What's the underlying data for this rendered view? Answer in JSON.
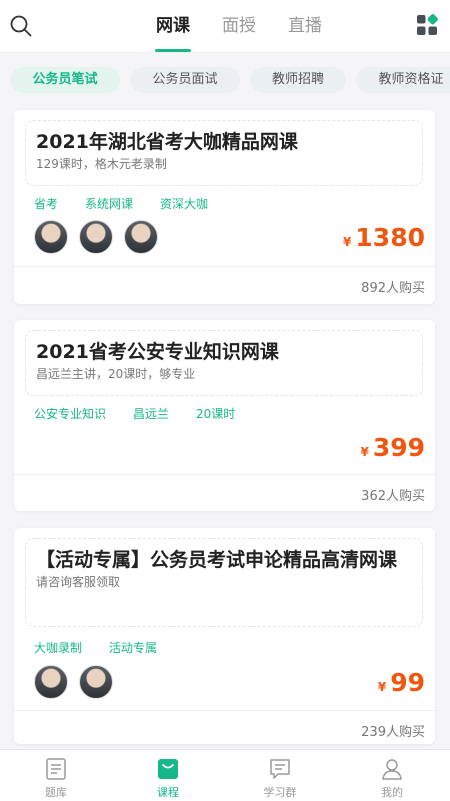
{
  "header": {
    "tabs": [
      {
        "label": "网课",
        "active": true
      },
      {
        "label": "面授",
        "active": false
      },
      {
        "label": "直播",
        "active": false
      }
    ],
    "icons": {
      "left": "search-icon",
      "right": "apps-grid-icon"
    }
  },
  "categories": [
    {
      "label": "公务员笔试",
      "active": true
    },
    {
      "label": "公务员面试",
      "active": false
    },
    {
      "label": "教师招聘",
      "active": false
    },
    {
      "label": "教师资格证",
      "active": false
    }
  ],
  "courses": [
    {
      "title": "2021年湖北省考大咖精品网课",
      "subtitle": "129课时，格木元老录制",
      "tags": [
        "省考",
        "系统网课",
        "资深大咖"
      ],
      "teacher_count": 3,
      "currency": "¥",
      "price": "1380",
      "buyers": "892人购买"
    },
    {
      "title": "2021省考公安专业知识网课",
      "subtitle": "昌远兰主讲，20课时，够专业",
      "tags": [
        "公安专业知识",
        "昌远兰",
        "20课时"
      ],
      "teacher_count": 0,
      "currency": "¥",
      "price": "399",
      "buyers": "362人购买"
    },
    {
      "title": "【活动专属】公务员考试申论精品高清网课",
      "subtitle": "请咨询客服领取",
      "tags": [
        "大咖录制",
        "活动专属"
      ],
      "teacher_count": 2,
      "currency": "¥",
      "price": "99",
      "buyers": "239人购买"
    }
  ],
  "bottom_nav": [
    {
      "label": "题库",
      "icon": "question-bank-icon",
      "active": false
    },
    {
      "label": "课程",
      "icon": "course-bag-icon",
      "active": true
    },
    {
      "label": "学习群",
      "icon": "chat-group-icon",
      "active": false
    },
    {
      "label": "我的",
      "icon": "profile-icon",
      "active": false
    }
  ],
  "colors": {
    "accent": "#16b889",
    "price": "#f0560f"
  }
}
